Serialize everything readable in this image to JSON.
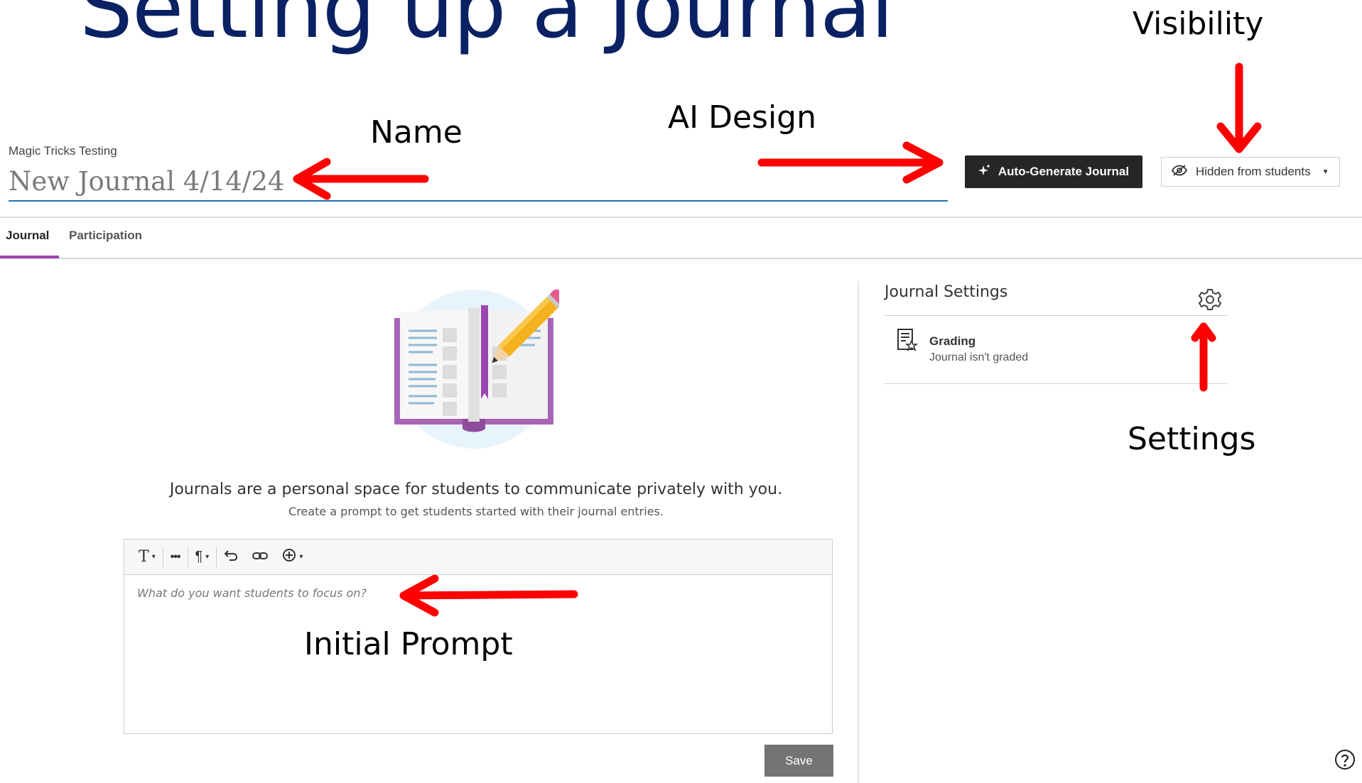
{
  "slide": {
    "title": "Setting up a Journal",
    "callouts": {
      "visibility": "Visibility",
      "ai_design": "AI Design",
      "name": "Name",
      "settings": "Settings",
      "initial_prompt": "Initial Prompt"
    },
    "arrow_color": "#ff0000"
  },
  "header": {
    "course_name": "Magic Tricks Testing",
    "journal_name_placeholder": "New Journal 4/14/24",
    "auto_generate_label": "Auto-Generate Journal",
    "visibility_label": "Hidden from students"
  },
  "tabs": [
    {
      "label": "Journal",
      "active": true
    },
    {
      "label": "Participation",
      "active": false
    }
  ],
  "empty_state": {
    "title": "Journals are a personal space for students to communicate privately with you.",
    "subtitle": "Create a prompt to get students started with their journal entries.",
    "illustration_icon": "open-book-pencil-icon"
  },
  "editor": {
    "placeholder": "What do you want students to focus on?",
    "toolbar_icons": [
      "text-style-icon",
      "more-icon",
      "paragraph-icon",
      "undo-icon",
      "link-icon",
      "insert-icon"
    ],
    "save_label": "Save"
  },
  "settings": {
    "title": "Journal Settings",
    "grading_label": "Grading",
    "grading_value": "Journal isn't graded"
  },
  "colors": {
    "title_navy": "#0a2164",
    "accent_purple": "#9b46b0",
    "input_underline": "#1f6fb5",
    "button_dark": "#262626",
    "save_gray": "#747474"
  }
}
